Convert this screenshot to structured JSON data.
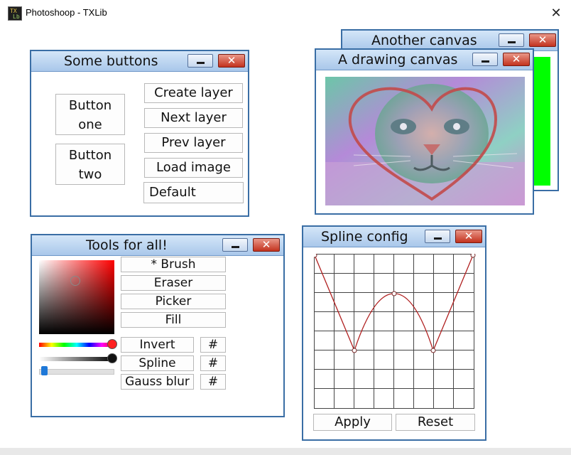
{
  "app": {
    "title": "Photoshoop - TXLib",
    "icon": "txlib-app-icon",
    "close_glyph": "✕"
  },
  "panels": {
    "buttons": {
      "title": "Some buttons",
      "button_one": [
        "Button",
        "one"
      ],
      "button_two": [
        "Button",
        "two"
      ],
      "create_layer": "Create layer",
      "next_layer": "Next layer",
      "prev_layer": "Prev layer",
      "load_image": "Load image",
      "default": "Default"
    },
    "another_canvas": {
      "title": "Another canvas",
      "fill_color": "#00ff00"
    },
    "drawing_canvas": {
      "title": "A drawing canvas",
      "image": "cat-photo-with-heart-outline"
    },
    "tools": {
      "title": "Tools for all!",
      "brush": "* Brush",
      "eraser": "Eraser",
      "picker": "Picker",
      "fill": "Fill",
      "invert": "Invert",
      "spline": "Spline",
      "gauss_blur": "Gauss blur",
      "hash": "#",
      "selected_hue": "#ff0000"
    },
    "spline": {
      "title": "Spline config",
      "apply": "Apply",
      "reset": "Reset"
    }
  },
  "window_controls": {
    "close_glyph": "✕"
  },
  "colors": {
    "title_bar_top": "#d4e6f8",
    "title_bar_bottom": "#a9c7ea",
    "close_button": "#c3321e",
    "frame": "#3a6ea5",
    "spline_curve": "#b02020"
  }
}
